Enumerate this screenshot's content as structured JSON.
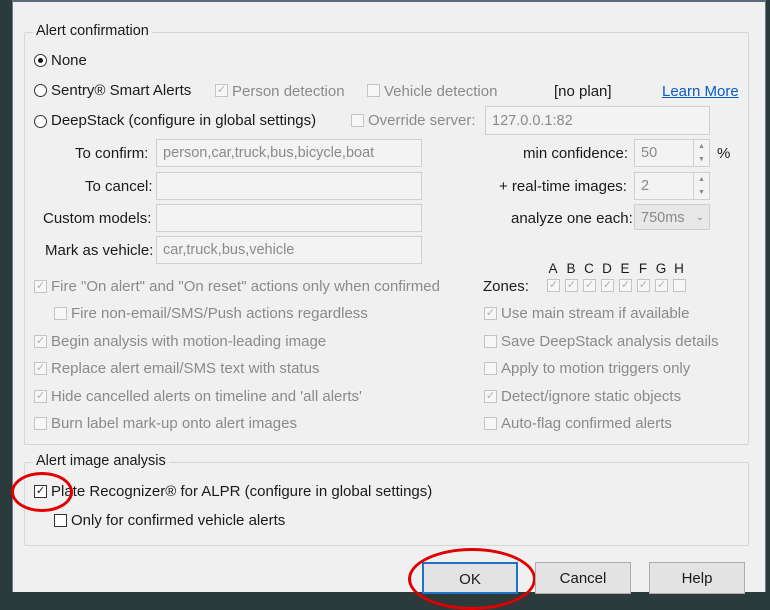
{
  "group_alert_confirmation": {
    "title": "Alert confirmation",
    "radio_none": "None",
    "radio_sentry": "Sentry® Smart Alerts",
    "person_detection": "Person detection",
    "vehicle_detection": "Vehicle detection",
    "no_plan": "[no plan]",
    "learn_more": "Learn More",
    "radio_deepstack": "DeepStack (configure in global settings)",
    "override_server": "Override server:",
    "server_value": "127.0.0.1:82",
    "to_confirm_label": "To confirm:",
    "to_confirm_value": "person,car,truck,bus,bicycle,boat",
    "to_cancel_label": "To cancel:",
    "to_cancel_value": "",
    "custom_models_label": "Custom models:",
    "custom_models_value": "",
    "mark_vehicle_label": "Mark as vehicle:",
    "mark_vehicle_value": "car,truck,bus,vehicle",
    "min_conf_label": "min confidence:",
    "min_conf_value": "50",
    "min_conf_unit": "%",
    "realtime_label": "+ real-time images:",
    "realtime_value": "2",
    "analyze_label": "analyze one each:",
    "analyze_value": "750ms",
    "zones_label": "Zones:",
    "zone_letters": [
      "A",
      "B",
      "C",
      "D",
      "E",
      "F",
      "G",
      "H"
    ],
    "left_options": [
      "Fire \"On alert\" and \"On reset\" actions only when confirmed",
      "Fire non-email/SMS/Push actions regardless",
      "Begin analysis with motion-leading image",
      "Replace alert email/SMS text with status",
      "Hide cancelled alerts on timeline and  'all alerts'",
      "Burn label mark-up onto alert images"
    ],
    "right_options": [
      "Use main stream if available",
      "Save DeepStack analysis details",
      "Apply to motion triggers only",
      "Detect/ignore static objects",
      "Auto-flag confirmed alerts"
    ]
  },
  "group_image_analysis": {
    "title": "Alert image analysis",
    "plate_recognizer": "Plate Recognizer® for ALPR (configure in global settings)",
    "only_confirmed": "Only for confirmed vehicle alerts"
  },
  "buttons": {
    "ok": "OK",
    "cancel": "Cancel",
    "help": "Help"
  },
  "colors": {
    "annotation_ring": "#e00000",
    "link": "#0a5cc4"
  }
}
